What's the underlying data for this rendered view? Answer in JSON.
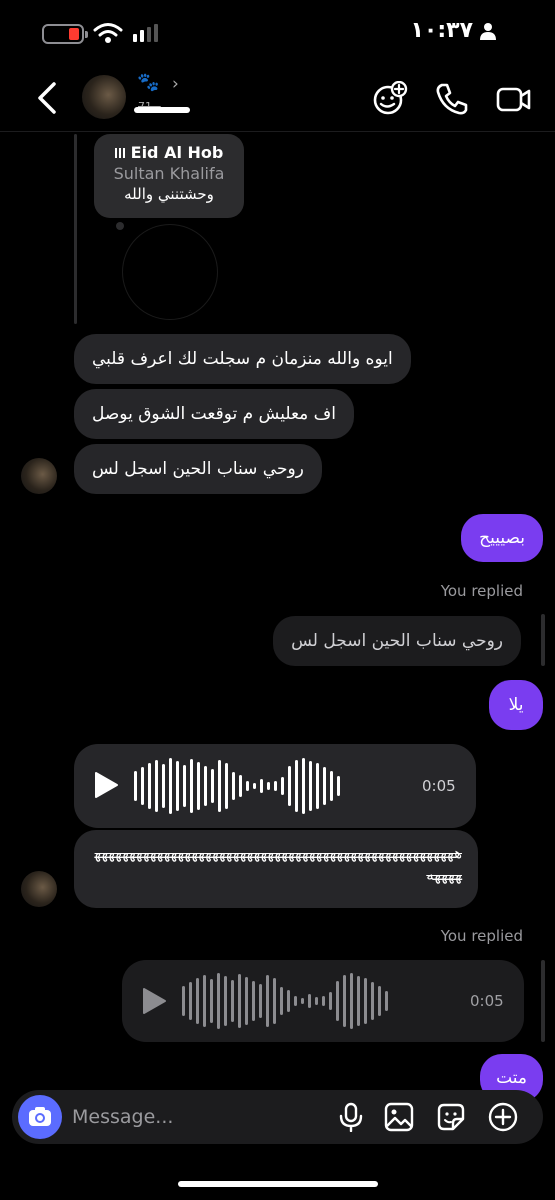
{
  "status_bar": {
    "time": "١٠:٣٧",
    "battery_color": "#ff3b30"
  },
  "header": {
    "emoji": "🐾",
    "username": "71_ـ"
  },
  "note": {
    "title": "Eid Al Hob",
    "artist": "Sultan Khalifa",
    "text": "وحشتنني والله"
  },
  "messages": [
    {
      "text": "ايوه والله منزمان م سجلت لك اعرف قلبي"
    },
    {
      "text": "اف معليش م توقعت الشوق يوصل"
    },
    {
      "text": "روحي سناب الحين اسجل لس"
    },
    {
      "text": "بصيييح"
    },
    {
      "replied_label": "You replied",
      "quoted": "روحي سناب الحين اسجل لس"
    },
    {
      "text": "يلا"
    },
    {
      "voice_duration": "0:05"
    },
    {
      "text": "هههههههههههههههههههههههههههههههههههههههههههههههههههههههههه"
    },
    {
      "replied_label": "You replied",
      "voice_duration": "0:05"
    },
    {
      "text": "متت"
    }
  ],
  "composer": {
    "placeholder": "Message..."
  },
  "colors": {
    "accent_purple": "#7a3df0",
    "camera_blue": "#5b6cff"
  },
  "icons": [
    "back-icon",
    "chevron-right-icon",
    "sticker-effects-icon",
    "phone-icon",
    "video-icon",
    "play-icon",
    "camera-icon",
    "microphone-icon",
    "gallery-icon",
    "sticker-icon",
    "plus-icon"
  ]
}
